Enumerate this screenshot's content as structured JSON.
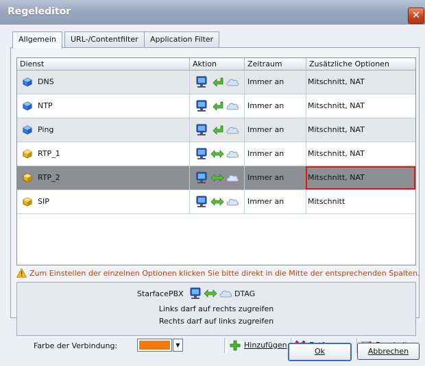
{
  "window": {
    "title": "Regeleditor",
    "close_symbol": "✕"
  },
  "tabs": [
    "Allgemein",
    "URL-/Contentfilter",
    "Application Filter"
  ],
  "table": {
    "headers": [
      "Dienst",
      "Aktion",
      "Zeitraum",
      "Zusätzliche Optionen"
    ],
    "rows": [
      {
        "name": "DNS",
        "icon": "blue-cube-icon",
        "action": "left-arrow-icon",
        "zeitraum": "Immer an",
        "optionen": "Mitschnitt, NAT",
        "style": "gray"
      },
      {
        "name": "NTP",
        "icon": "blue-cube-icon",
        "action": "left-arrow-icon",
        "zeitraum": "Immer an",
        "optionen": "Mitschnitt, NAT",
        "style": "white"
      },
      {
        "name": "Ping",
        "icon": "blue-cube-icon",
        "action": "left-arrow-icon",
        "zeitraum": "Immer an",
        "optionen": "Mitschnitt, NAT",
        "style": "gray"
      },
      {
        "name": "RTP_1",
        "icon": "yellow-cube-icon",
        "action": "double-arrow-icon",
        "zeitraum": "Immer an",
        "optionen": "Mitschnitt, NAT",
        "style": "white"
      },
      {
        "name": "RTP_2",
        "icon": "yellow-cube-icon",
        "action": "double-arrow-icon",
        "zeitraum": "Immer an",
        "optionen": "Mitschnitt, NAT",
        "style": "selected"
      },
      {
        "name": "SIP",
        "icon": "yellow-cube-icon",
        "action": "double-arrow-icon",
        "zeitraum": "Immer an",
        "optionen": "Mitschnitt",
        "style": "white"
      }
    ]
  },
  "warning": "Zum Einstellen der einzelnen Optionen klicken Sie bitte direkt in die Mitte der entsprechenden Spalten.",
  "connection": {
    "left": "StarfacePBX",
    "right": "DTAG",
    "line1": "Links darf auf rechts zugreifen",
    "line2": "Rechts darf auf links zugreifen"
  },
  "toolbar": {
    "color_label": "Farbe der Verbindung:",
    "color_value": "#f07a0c",
    "add_label": "Hinzufügen",
    "remove_label": "Entfernen",
    "edit_label": "Bearbeiten"
  },
  "buttons": {
    "ok": "Ok",
    "cancel": "Abbrechen"
  }
}
